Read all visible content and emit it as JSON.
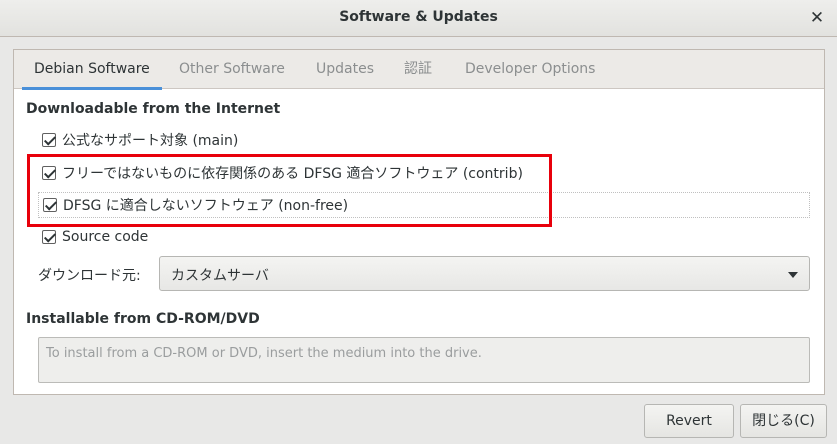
{
  "window": {
    "title": "Software & Updates",
    "close_glyph": "✕"
  },
  "tabs": [
    {
      "label": "Debian Software",
      "active": true
    },
    {
      "label": "Other Software",
      "active": false
    },
    {
      "label": "Updates",
      "active": false
    },
    {
      "label": "認証",
      "active": false
    },
    {
      "label": "Developer Options",
      "active": false
    }
  ],
  "internet_section": {
    "heading": "Downloadable from the Internet",
    "components": [
      {
        "label": "公式なサポート対象 (main)",
        "checked": true
      },
      {
        "label": "フリーではないものに依存関係のある DFSG 適合ソフトウェア (contrib)",
        "checked": true
      },
      {
        "label": "DFSG に適合しないソフトウェア (non-free)",
        "checked": true
      },
      {
        "label": "Source code",
        "checked": true
      }
    ],
    "download_from_label": "ダウンロード元:",
    "download_from_value": "カスタムサーバ"
  },
  "cdrom_section": {
    "heading": "Installable from CD-ROM/DVD",
    "message": "To install from a CD-ROM or DVD, insert the medium into the drive."
  },
  "buttons": {
    "revert": "Revert",
    "close": "閉じる(C)"
  },
  "colors": {
    "accent": "#4a90d9",
    "highlight": "#e8000b"
  }
}
